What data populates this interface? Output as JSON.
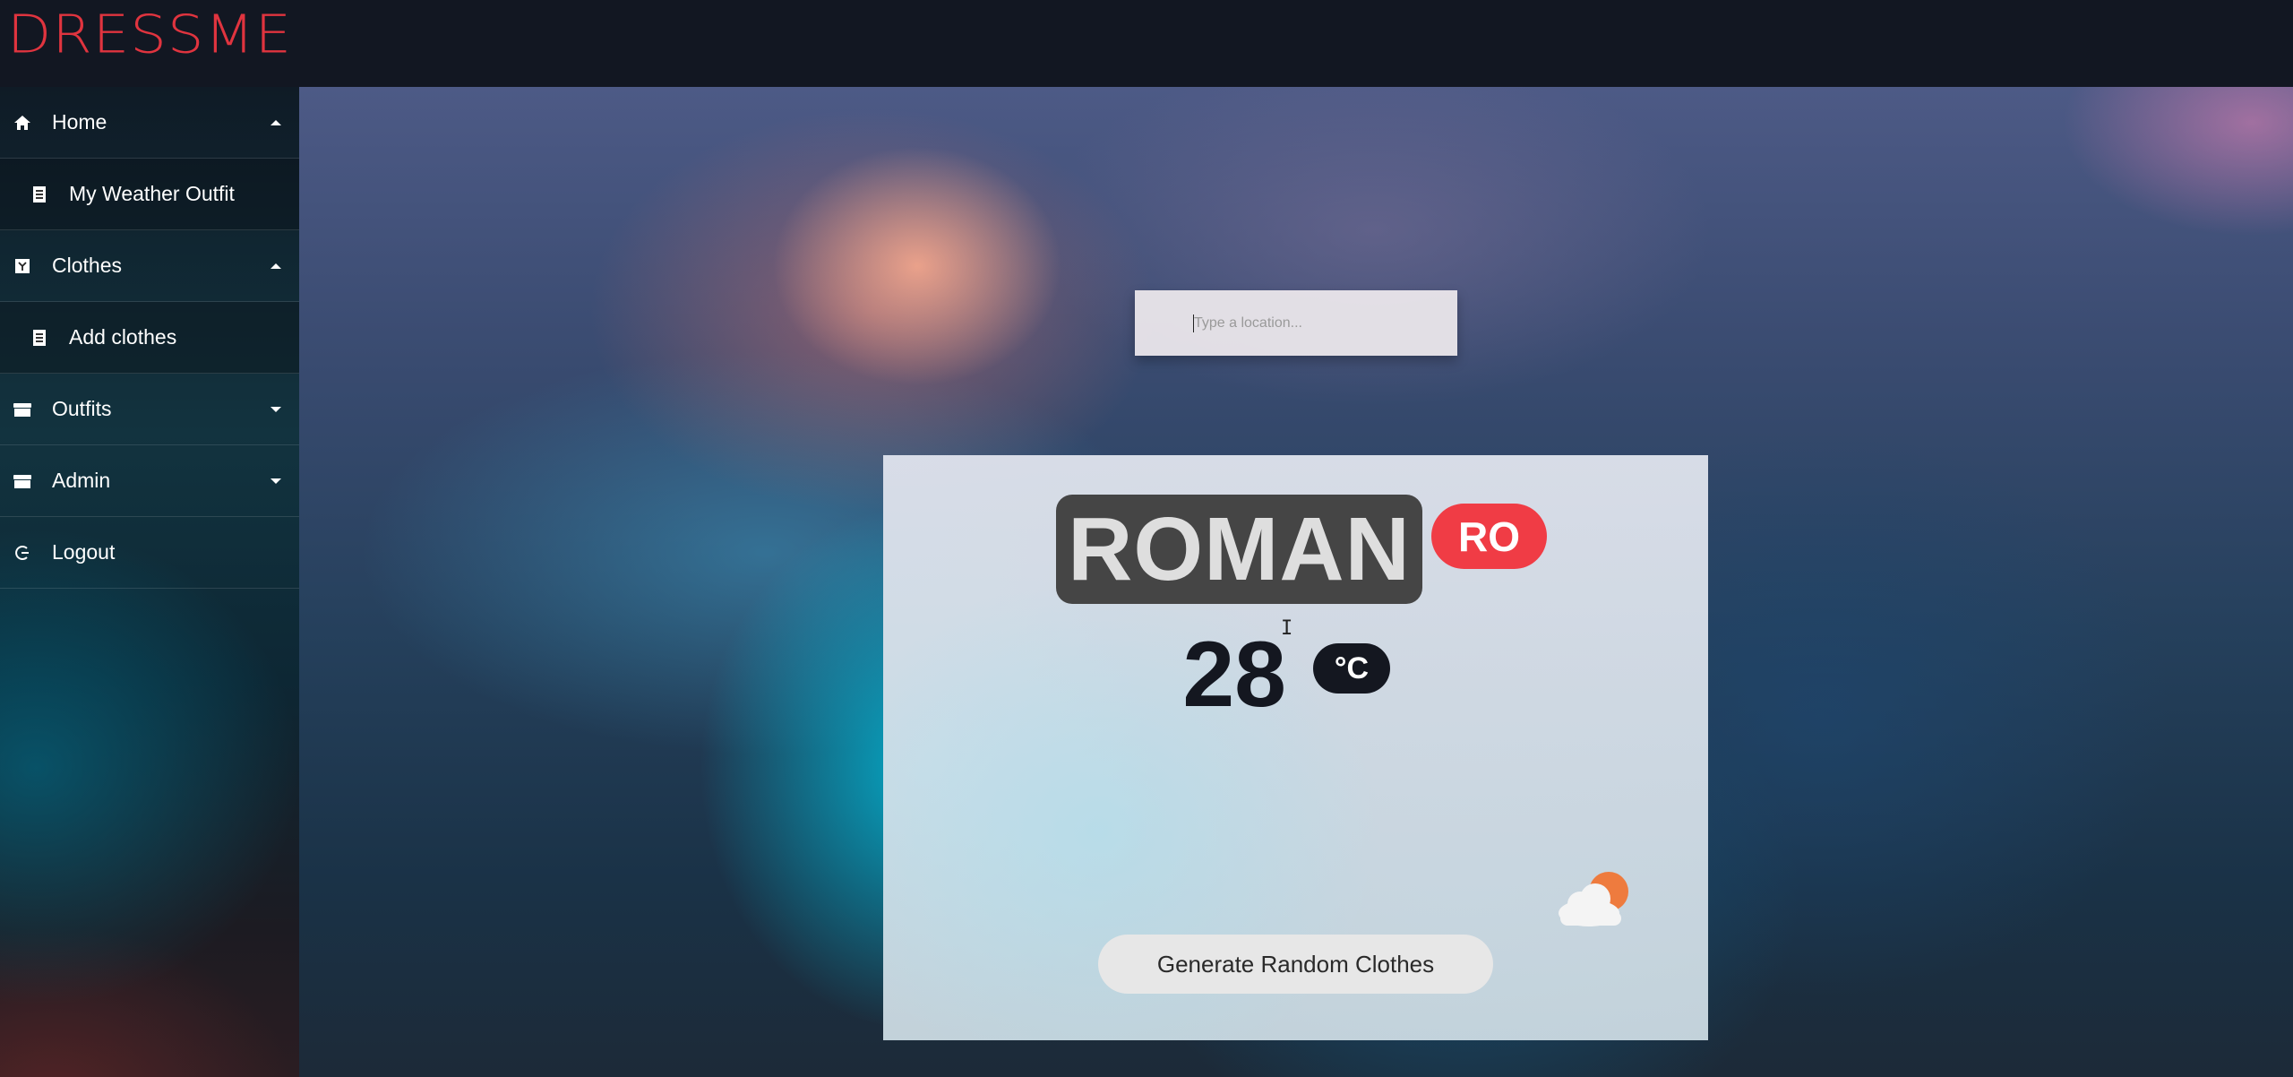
{
  "app": {
    "logo": "DRESSME"
  },
  "sidebar": {
    "items": [
      {
        "label": "Home",
        "icon": "home-icon",
        "caret": "up"
      },
      {
        "label": "My Weather Outfit",
        "icon": "document-icon",
        "sub": true
      },
      {
        "label": "Clothes",
        "icon": "clothes-icon",
        "caret": "up"
      },
      {
        "label": "Add clothes",
        "icon": "document-icon",
        "sub": true
      },
      {
        "label": "Outfits",
        "icon": "box-icon",
        "caret": "down"
      },
      {
        "label": "Admin",
        "icon": "box-icon",
        "caret": "down"
      },
      {
        "label": "Logout",
        "icon": "logout-icon"
      }
    ]
  },
  "search": {
    "placeholder": "Type a location...",
    "value": ""
  },
  "weather": {
    "city": "ROMAN",
    "country": "RO",
    "temperature": "28",
    "unit": "°C",
    "description": "-few clouds-",
    "icon": "few-clouds-icon"
  },
  "actions": {
    "generate_label": "Generate Random Clothes"
  },
  "colors": {
    "brand": "#e0343f",
    "country_badge": "#f03c45",
    "topbar": "#121722"
  }
}
